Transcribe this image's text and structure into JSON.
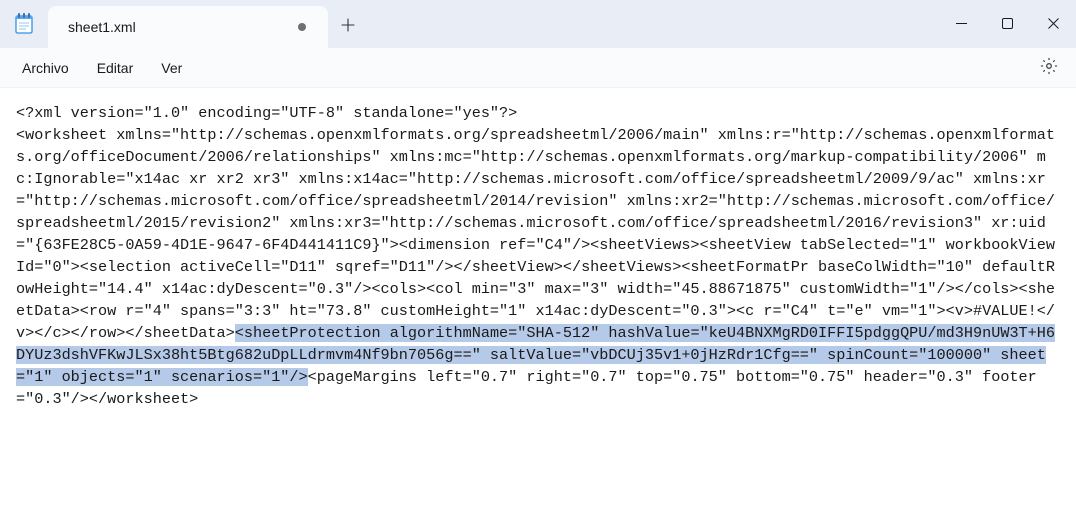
{
  "tab": {
    "title": "sheet1.xml"
  },
  "menu": {
    "file": "Archivo",
    "edit": "Editar",
    "view": "Ver"
  },
  "icons": {
    "app": "notepad-icon",
    "newtab": "plus-icon",
    "min": "minimize-icon",
    "max": "maximize-icon",
    "close": "close-icon",
    "settings": "gear-icon"
  },
  "content": {
    "pre1": "<?xml version=\"1.0\" encoding=\"UTF-8\" standalone=\"yes\"?>\n<worksheet xmlns=\"http://schemas.openxmlformats.org/spreadsheetml/2006/main\" xmlns:r=\"http://schemas.openxmlformats.org/officeDocument/2006/relationships\" xmlns:mc=\"http://schemas.openxmlformats.org/markup-compatibility/2006\" mc:Ignorable=\"x14ac xr xr2 xr3\" xmlns:x14ac=\"http://schemas.microsoft.com/office/spreadsheetml/2009/9/ac\" xmlns:xr=\"http://schemas.microsoft.com/office/spreadsheetml/2014/revision\" xmlns:xr2=\"http://schemas.microsoft.com/office/spreadsheetml/2015/revision2\" xmlns:xr3=\"http://schemas.microsoft.com/office/spreadsheetml/2016/revision3\" xr:uid=\"{63FE28C5-0A59-4D1E-9647-6F4D441411C9}\"><dimension ref=\"C4\"/><sheetViews><sheetView tabSelected=\"1\" workbookViewId=\"0\"><selection activeCell=\"D11\" sqref=\"D11\"/></sheetView></sheetViews><sheetFormatPr baseColWidth=\"10\" defaultRowHeight=\"14.4\" x14ac:dyDescent=\"0.3\"/><cols><col min=\"3\" max=\"3\" width=\"45.88671875\" customWidth=\"1\"/></cols><sheetData><row r=\"4\" spans=\"3:3\" ht=\"73.8\" customHeight=\"1\" x14ac:dyDescent=\"0.3\"><c r=\"C4\" t=\"e\" vm=\"1\"><v>#VALUE!</v></c></row></sheetData>",
    "sel": "<sheetProtection algorithmName=\"SHA-512\" hashValue=\"keU4BNXMgRD0IFFI5pdggQPU/md3H9nUW3T+H6DYUz3dshVFKwJLSx38ht5Btg682uDpLLdrmvm4Nf9bn7056g==\" saltValue=\"vbDCUj35v1+0jHzRdr1Cfg==\" spinCount=\"100000\" sheet=\"1\" objects=\"1\" scenarios=\"1\"/>",
    "post1": "<pageMargins left=\"0.7\" right=\"0.7\" top=\"0.75\" bottom=\"0.75\" header=\"0.3\" footer=\"0.3\"/></worksheet>"
  }
}
